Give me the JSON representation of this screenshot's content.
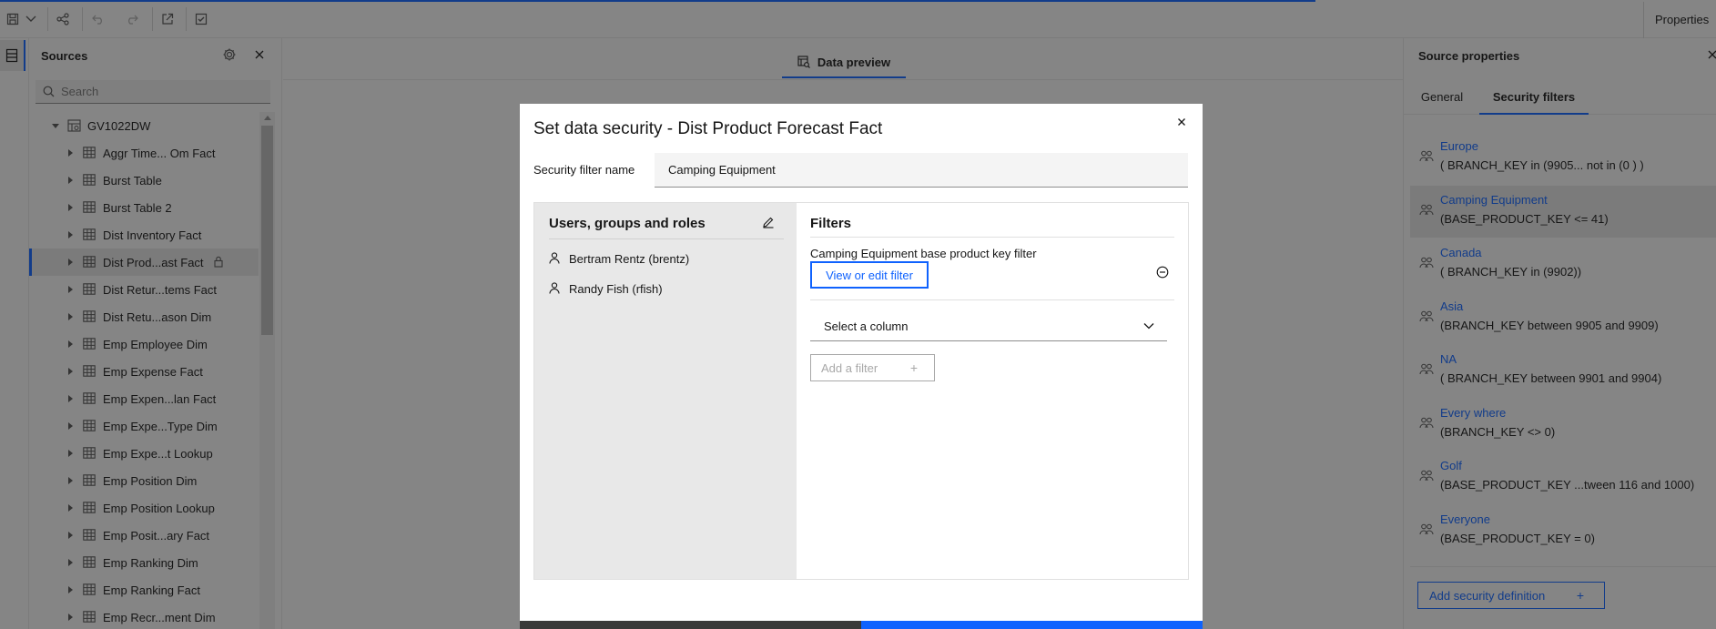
{
  "topbar": {
    "properties_label": "Properties"
  },
  "sources": {
    "title": "Sources",
    "search_placeholder": "Search",
    "root": "GV1022DW",
    "items": [
      {
        "label": "Aggr Time... Om Fact"
      },
      {
        "label": "Burst Table"
      },
      {
        "label": "Burst Table 2"
      },
      {
        "label": "Dist Inventory Fact"
      },
      {
        "label": "Dist Prod...ast Fact",
        "selected": true,
        "locked": true
      },
      {
        "label": "Dist Retur...tems Fact"
      },
      {
        "label": "Dist Retu...ason Dim"
      },
      {
        "label": "Emp Employee Dim"
      },
      {
        "label": "Emp Expense Fact"
      },
      {
        "label": "Emp Expen...lan Fact"
      },
      {
        "label": "Emp Expe...Type Dim"
      },
      {
        "label": "Emp Expe...t Lookup"
      },
      {
        "label": "Emp Position Dim"
      },
      {
        "label": "Emp Position Lookup"
      },
      {
        "label": "Emp Posit...ary Fact"
      },
      {
        "label": "Emp Ranking Dim"
      },
      {
        "label": "Emp Ranking Fact"
      },
      {
        "label": "Emp Recr...ment Dim"
      }
    ]
  },
  "preview": {
    "tab_label": "Data preview"
  },
  "props": {
    "title": "Source properties",
    "tabs": [
      "General",
      "Security filters"
    ],
    "filters": [
      {
        "name": "Europe",
        "expr": "( BRANCH_KEY in (9905... not in (0 ) )"
      },
      {
        "name": "Camping Equipment",
        "expr": "(BASE_PRODUCT_KEY <= 41)",
        "active": true
      },
      {
        "name": "Canada",
        "expr": "( BRANCH_KEY in (9902))"
      },
      {
        "name": "Asia",
        "expr": "(BRANCH_KEY between 9905 and 9909)"
      },
      {
        "name": "NA",
        "expr": "( BRANCH_KEY between 9901 and 9904)"
      },
      {
        "name": "Every where",
        "expr": "(BRANCH_KEY <> 0)"
      },
      {
        "name": "Golf",
        "expr": "(BASE_PRODUCT_KEY ...tween 116 and 1000)"
      },
      {
        "name": "Everyone",
        "expr": "(BASE_PRODUCT_KEY = 0)"
      }
    ],
    "add_button": "Add security definition"
  },
  "modal": {
    "title": "Set data security - Dist Product Forecast Fact",
    "sf_label": "Security filter name",
    "sf_value": "Camping Equipment",
    "ugr_title": "Users, groups and roles",
    "users": [
      "Bertram Rentz (brentz)",
      "Randy Fish (rfish)"
    ],
    "filters_title": "Filters",
    "filter_desc": "Camping Equipment base product key filter",
    "view_edit": "View or edit filter",
    "select_column": "Select a column",
    "add_filter": "Add a filter"
  },
  "colors": {
    "accent": "#0f62fe",
    "overlay": "rgba(22,22,22,0.5)"
  }
}
